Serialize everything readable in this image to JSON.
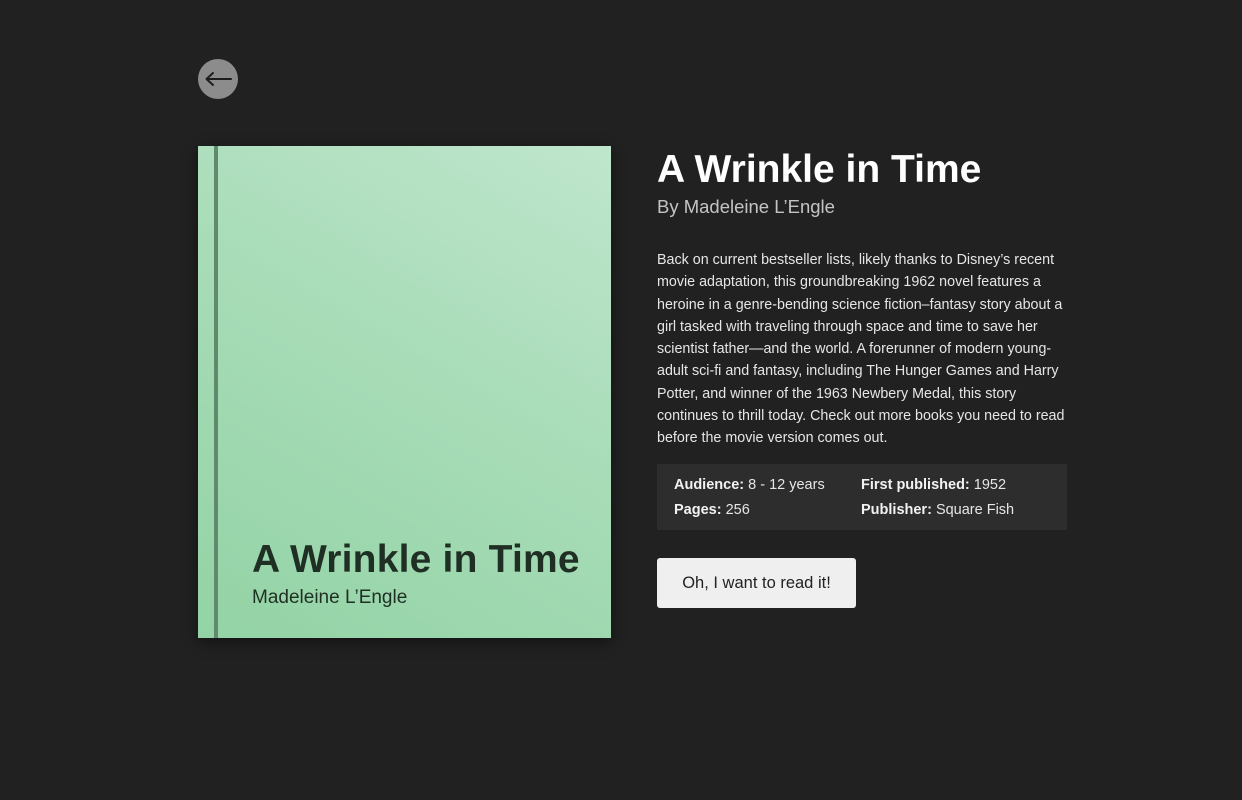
{
  "nav": {
    "back_icon": "arrow-left-icon"
  },
  "cover": {
    "title": "A Wrinkle in Time",
    "author": "Madeleine L’Engle",
    "colors": {
      "background_light": "#bfe6cc",
      "background_dark": "#93d3a5",
      "spine": "#5f8a6b",
      "text": "#1f2f24"
    }
  },
  "book": {
    "title": "A Wrinkle in Time",
    "byline": "By Madeleine L’Engle",
    "description": "Back on current bestseller lists, likely thanks to Disney’s recent movie adaptation, this groundbreaking 1962 novel features a heroine in a genre-bending science fiction–fantasy story about a girl tasked with traveling through space and time to save her scientist father—and the world. A forerunner of modern young-adult sci-fi and fantasy, including The Hunger Games and Harry Potter, and winner of the 1963 Newbery Medal, this story continues to thrill today. Check out more books you need to read before the movie version comes out."
  },
  "meta": {
    "audience_label": "Audience:",
    "audience_value": "8 - 12 years",
    "first_published_label": "First published:",
    "first_published_value": "1952",
    "pages_label": "Pages:",
    "pages_value": "256",
    "publisher_label": "Publisher:",
    "publisher_value": "Square Fish"
  },
  "actions": {
    "read_label": "Oh, I want to read it!"
  },
  "theme": {
    "page_background": "#212121",
    "panel_background": "#2d2d2d",
    "button_background": "#efefef"
  }
}
